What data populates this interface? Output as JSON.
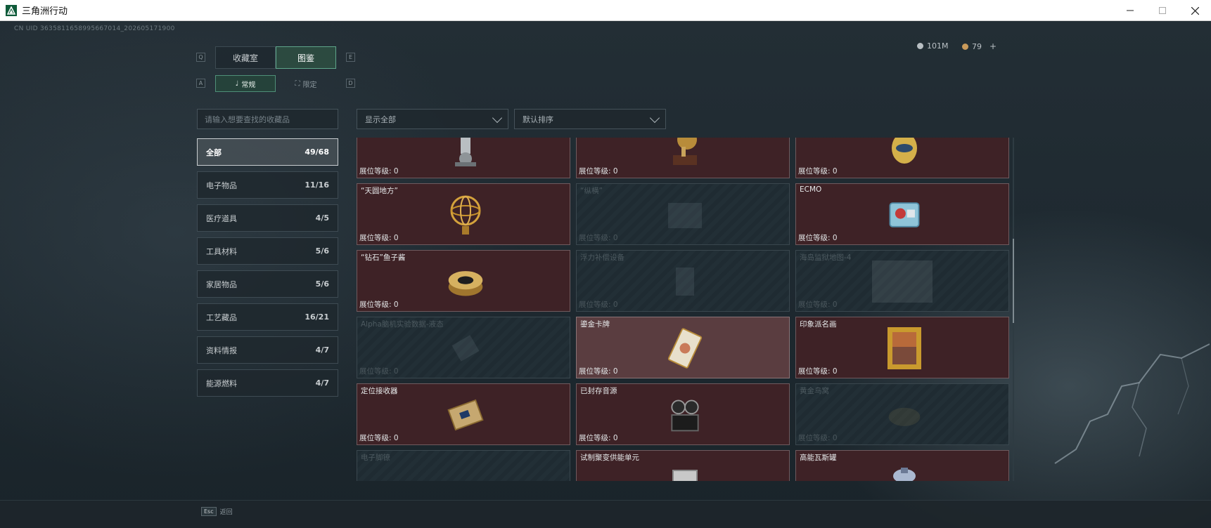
{
  "window": {
    "title": "三角洲行动"
  },
  "uid": "CN UID 3635811658995667014_202605171900",
  "currency": {
    "silver": "101M",
    "gold": "79"
  },
  "keyhints": {
    "left_tab": "Q",
    "right_tab": "E",
    "left_sub": "A",
    "right_sub": "D"
  },
  "tabs": [
    {
      "label": "收藏室"
    },
    {
      "label": "图鉴"
    }
  ],
  "subtabs": [
    {
      "label": "常规"
    },
    {
      "label": "限定"
    }
  ],
  "search": {
    "placeholder": "请输入想要查找的收藏品"
  },
  "filters": [
    {
      "selected": "显示全部"
    },
    {
      "selected": "默认排序"
    }
  ],
  "categories": [
    {
      "label": "全部",
      "count": "49/68"
    },
    {
      "label": "电子物品",
      "count": "11/16"
    },
    {
      "label": "医疗道具",
      "count": "4/5"
    },
    {
      "label": "工具材料",
      "count": "5/6"
    },
    {
      "label": "家居物品",
      "count": "5/6"
    },
    {
      "label": "工艺藏品",
      "count": "16/21"
    },
    {
      "label": "资料情报",
      "count": "4/7"
    },
    {
      "label": "能源燃料",
      "count": "4/7"
    }
  ],
  "cards": [
    {
      "name": "",
      "level": "展位等级: 0",
      "state": "owned",
      "icon": "robot-arm-icon"
    },
    {
      "name": "",
      "level": "展位等级: 0",
      "state": "owned",
      "icon": "gramophone-icon"
    },
    {
      "name": "",
      "level": "展位等级: 0",
      "state": "owned",
      "icon": "jeweled-egg-icon"
    },
    {
      "name": "“天圆地方”",
      "level": "展位等级: 0",
      "state": "owned",
      "icon": "armillary-sphere-icon"
    },
    {
      "name": "“纵横”",
      "level": "展位等级: 0",
      "state": "locked",
      "icon": "board-icon"
    },
    {
      "name": "ECMO",
      "level": "展位等级: 0",
      "state": "owned",
      "icon": "ecmo-machine-icon"
    },
    {
      "name": "“钻石”鱼子酱",
      "level": "展位等级: 0",
      "state": "owned",
      "icon": "caviar-tin-icon"
    },
    {
      "name": "浮力补偿设备",
      "level": "展位等级: 0",
      "state": "locked",
      "icon": "bcd-vest-icon"
    },
    {
      "name": "海岛监狱地图-4",
      "level": "展位等级: 0",
      "state": "locked",
      "icon": "map-icon"
    },
    {
      "name": "Alpha脑机实验数据-液态",
      "level": "展位等级: 0",
      "state": "locked",
      "icon": "data-device-icon"
    },
    {
      "name": "鎏金卡牌",
      "level": "展位等级: 0",
      "state": "highlight",
      "icon": "gilded-card-icon"
    },
    {
      "name": "印象派名画",
      "level": "展位等级: 0",
      "state": "owned",
      "icon": "painting-icon"
    },
    {
      "name": "定位接收器",
      "level": "展位等级: 0",
      "state": "owned",
      "icon": "receiver-icon"
    },
    {
      "name": "已封存音源",
      "level": "展位等级: 0",
      "state": "owned",
      "icon": "reel-recorder-icon"
    },
    {
      "name": "黄金鸟窝",
      "level": "展位等级: 0",
      "state": "locked",
      "icon": "golden-nest-icon"
    },
    {
      "name": "电子脚镣",
      "level": "",
      "state": "locked",
      "icon": "ankle-monitor-icon"
    },
    {
      "name": "试制聚变供能单元",
      "level": "",
      "state": "owned",
      "icon": "fusion-unit-icon"
    },
    {
      "name": "高能瓦斯罐",
      "level": "",
      "state": "owned",
      "icon": "gas-tank-icon"
    }
  ],
  "footer": {
    "key": "Esc",
    "label": "返回"
  }
}
